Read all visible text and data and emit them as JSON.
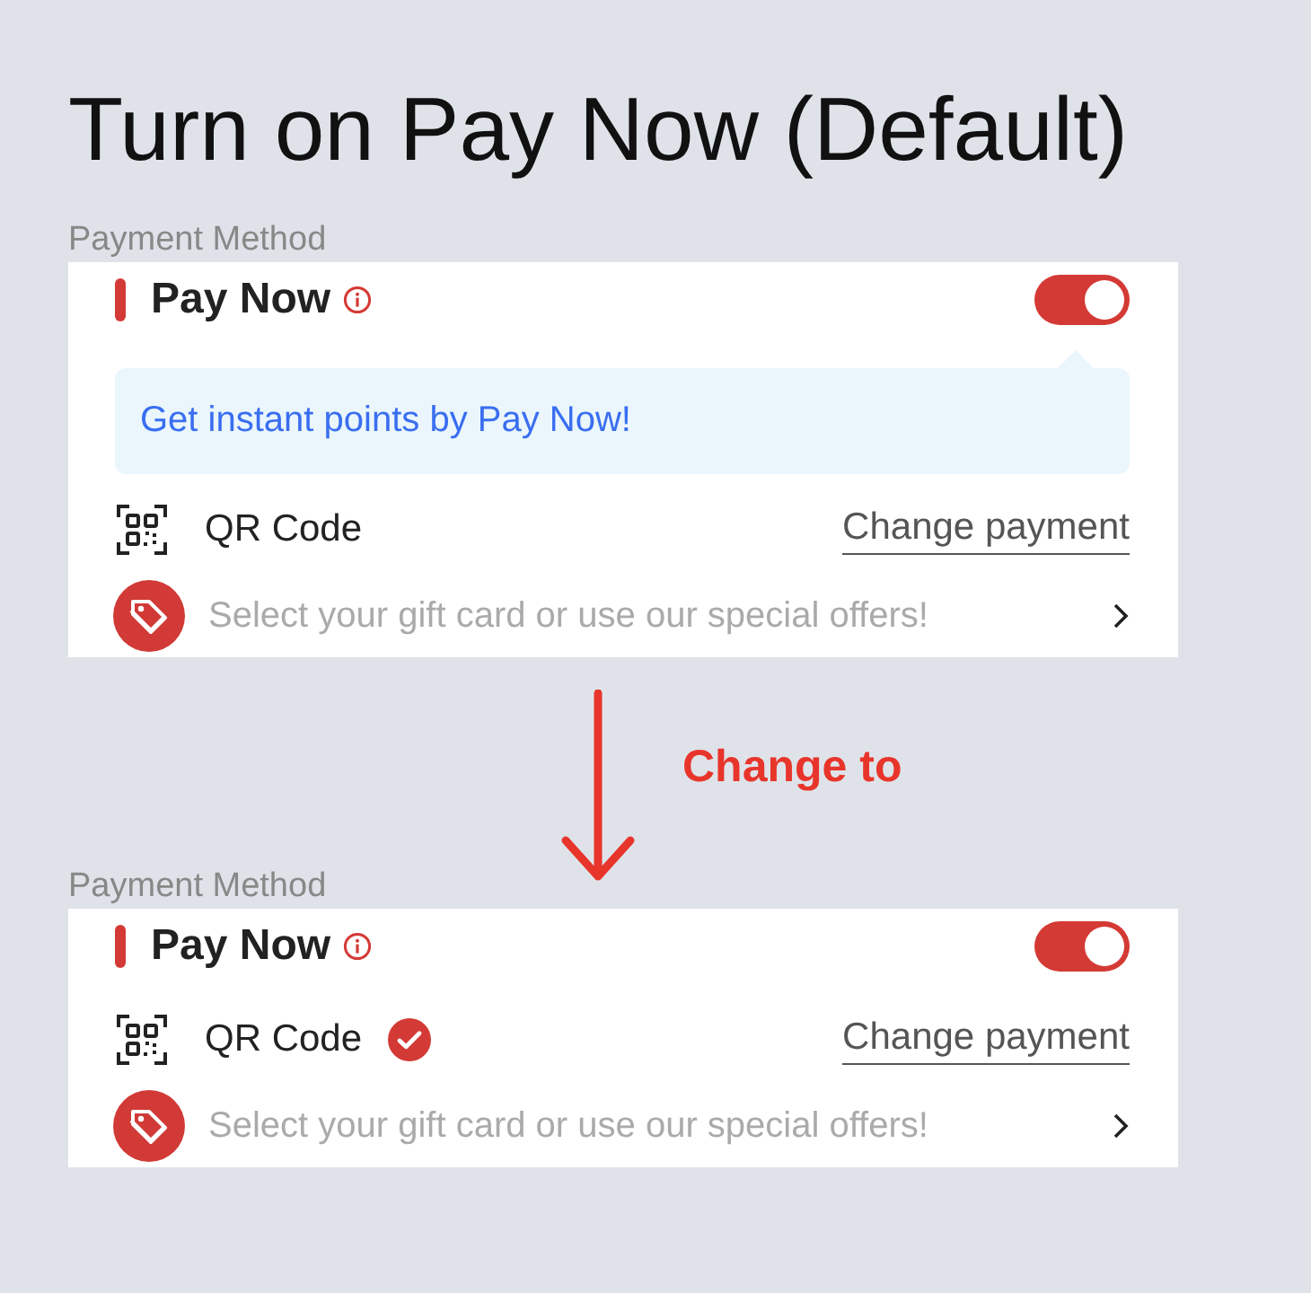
{
  "title": "Turn on Pay Now (Default)",
  "panels": [
    {
      "section_label": "Payment Method",
      "heading": "Pay Now",
      "toggle_on": true,
      "tip": "Get instant points by Pay Now!",
      "method": "QR Code",
      "method_checked": false,
      "change_link": "Change payment",
      "offer": "Select your gift card or use our special offers!"
    },
    {
      "section_label": "Payment Method",
      "heading": "Pay Now",
      "toggle_on": true,
      "method": "QR Code",
      "method_checked": true,
      "change_link": "Change payment",
      "offer": "Select your gift card or use our special offers!"
    }
  ],
  "annotation": "Change to"
}
